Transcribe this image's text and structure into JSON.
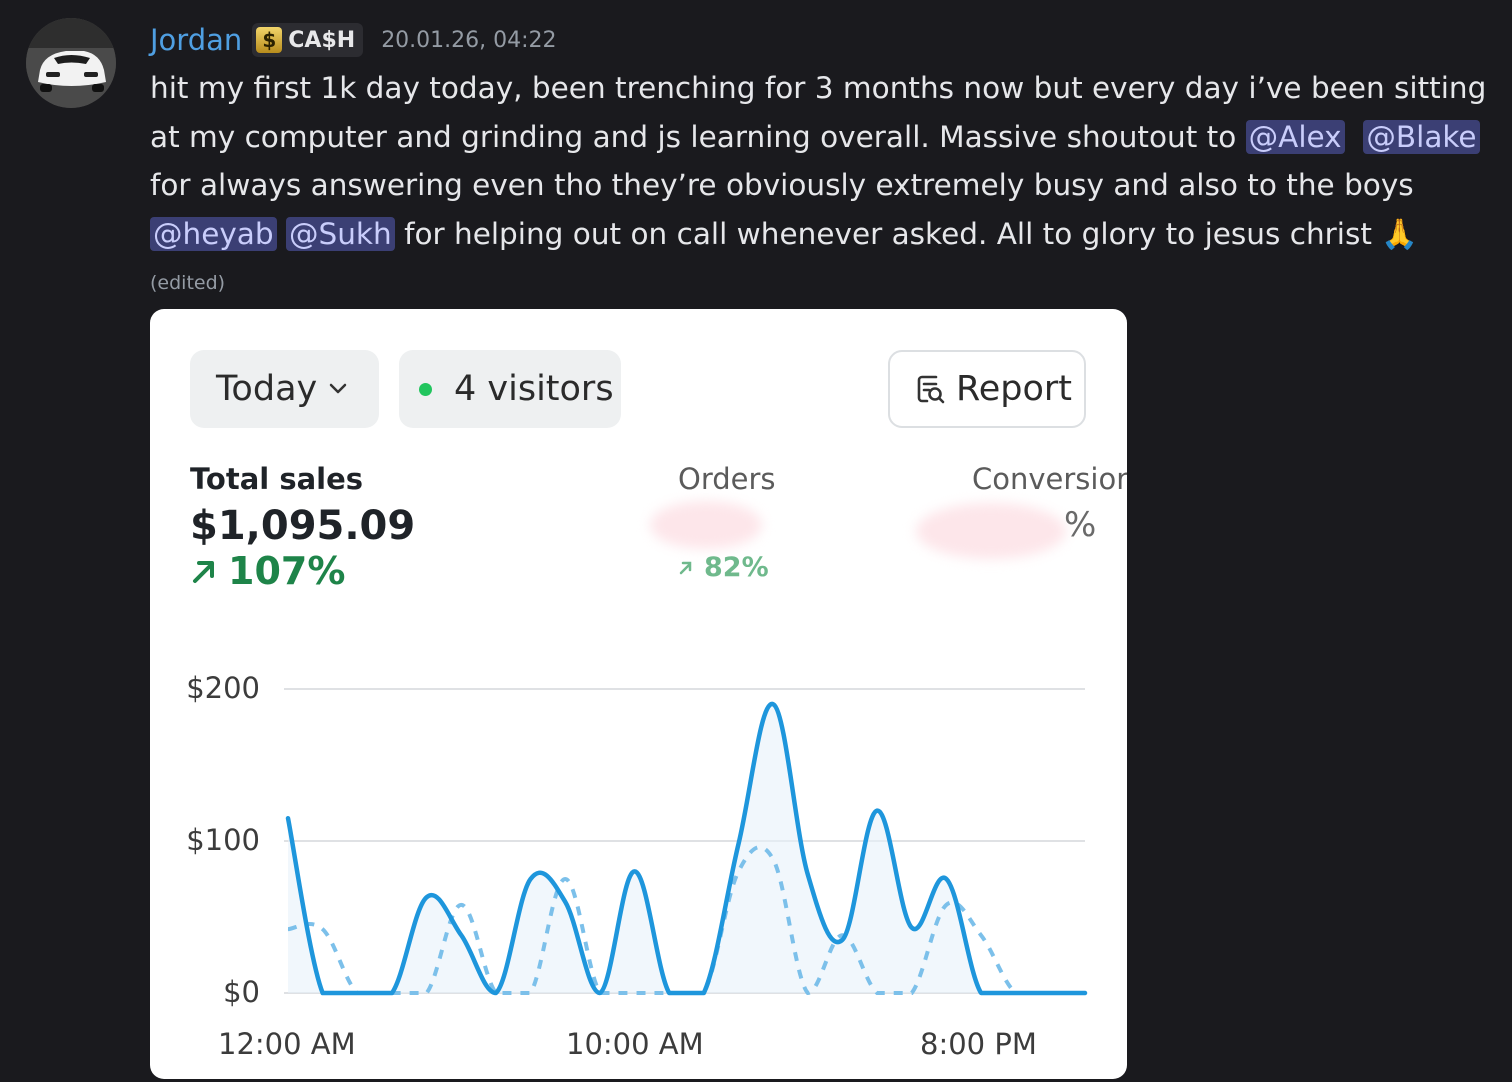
{
  "message": {
    "author": "Jordan",
    "role_tag": "CA$H",
    "role_icon": "dollar-sign-icon",
    "timestamp": "20.01.26, 04:22",
    "text_part1": "hit my first 1k day today, been trenching for 3 months now but every day i’ve been sitting at my computer and grinding and js learning overall. Massive shoutout to ",
    "mention1": "@Alex",
    "mention2": "@Blake",
    "text_part2": " for always answering even tho they’re obviously extremely busy and also to the boys ",
    "mention3": "@heyab",
    "mention4": "@Sukh",
    "text_part3": " for helping out on call whenever asked. All to glory to jesus christ ",
    "emoji": "🙏",
    "edited": "(edited)"
  },
  "embed": {
    "period": "Today",
    "visitors": "4 visitors",
    "report": "Report",
    "metrics": {
      "total_sales_label": "Total sales",
      "total_sales_value": "$1,095.09",
      "total_sales_change": "107%",
      "orders_label": "Orders",
      "orders_change": "82%",
      "conversion_label": "Conversion",
      "conversion_value_suffix": "%"
    },
    "colors": {
      "line": "#1e96dc",
      "positive": "#1e8449",
      "live": "#22c55e"
    }
  },
  "chart_data": {
    "type": "line",
    "title": "",
    "xlabel": "",
    "ylabel": "",
    "y_ticks": [
      "$200",
      "$100",
      "$0"
    ],
    "x_ticks": [
      "12:00 AM",
      "10:00 AM",
      "8:00 PM"
    ],
    "ylim": [
      0,
      200
    ],
    "x": [
      0,
      1,
      2,
      3,
      4,
      5,
      6,
      7,
      8,
      9,
      10,
      11,
      12,
      13,
      14,
      15,
      16,
      17,
      18,
      19,
      20,
      21,
      22,
      23
    ],
    "grid": true,
    "series": [
      {
        "style": "solid",
        "values": [
          115,
          0,
          0,
          0,
          63,
          38,
          0,
          75,
          60,
          0,
          80,
          0,
          0,
          98,
          190,
          78,
          35,
          120,
          43,
          75,
          0,
          0,
          0,
          0
        ]
      },
      {
        "style": "dashed",
        "values": [
          42,
          42,
          0,
          0,
          0,
          58,
          0,
          0,
          75,
          0,
          0,
          0,
          0,
          80,
          88,
          0,
          38,
          0,
          0,
          58,
          38,
          0,
          0,
          0
        ]
      }
    ]
  }
}
